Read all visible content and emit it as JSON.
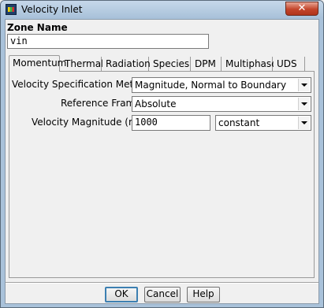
{
  "window": {
    "title": "Velocity Inlet",
    "close_glyph": "✕"
  },
  "zone": {
    "label": "Zone Name",
    "value": "vin"
  },
  "tabs": [
    {
      "label": "Momentum",
      "active": true
    },
    {
      "label": "Thermal"
    },
    {
      "label": "Radiation"
    },
    {
      "label": "Species"
    },
    {
      "label": "DPM"
    },
    {
      "label": "Multiphase"
    },
    {
      "label": "UDS"
    }
  ],
  "momentum": {
    "velocity_spec": {
      "label": "Velocity Specification Method",
      "value": "Magnitude, Normal to Boundary"
    },
    "reference_frame": {
      "label": "Reference Frame",
      "value": "Absolute"
    },
    "velocity_magnitude": {
      "label": "Velocity Magnitude (m/s)",
      "value": "1000",
      "profile": "constant"
    }
  },
  "buttons": {
    "ok": "OK",
    "cancel": "Cancel",
    "help": "Help"
  }
}
